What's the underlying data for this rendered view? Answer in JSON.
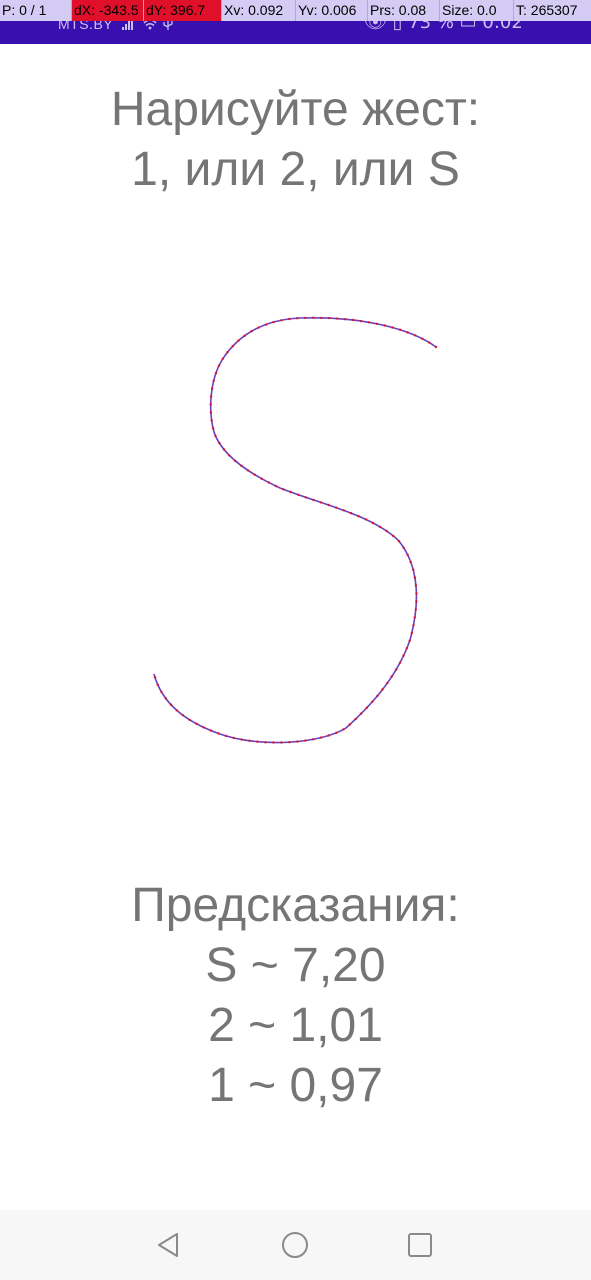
{
  "status_bar": {
    "carrier": "MTS.BY",
    "right_text": "👁 ▯ 73 % ▭ 0:02",
    "background": "#3a0fb0"
  },
  "pointer_overlay": {
    "pointers": "P: 0 / 1",
    "dx": "dX: -343.5",
    "dy": "dY: 396.7",
    "xv": "Xv: 0.092",
    "yv": "Yv: 0.006",
    "prs": "Prs: 0.08",
    "size": "Size: 0.0",
    "t": "T: 265307",
    "highlight_color": "#e0102a"
  },
  "prompt": {
    "line1": "Нарисуйте жест:",
    "line2": "1, или 2, или S"
  },
  "gesture": {
    "stroke_color": "#6b3fbf",
    "point_color": "#e0102a"
  },
  "predictions": {
    "title": "Предсказания:",
    "items": [
      "S ~ 7,20",
      "2 ~ 1,01",
      "1 ~ 0,97"
    ]
  },
  "nav": {
    "back": "back-icon",
    "home": "home-icon",
    "recents": "recents-icon"
  }
}
